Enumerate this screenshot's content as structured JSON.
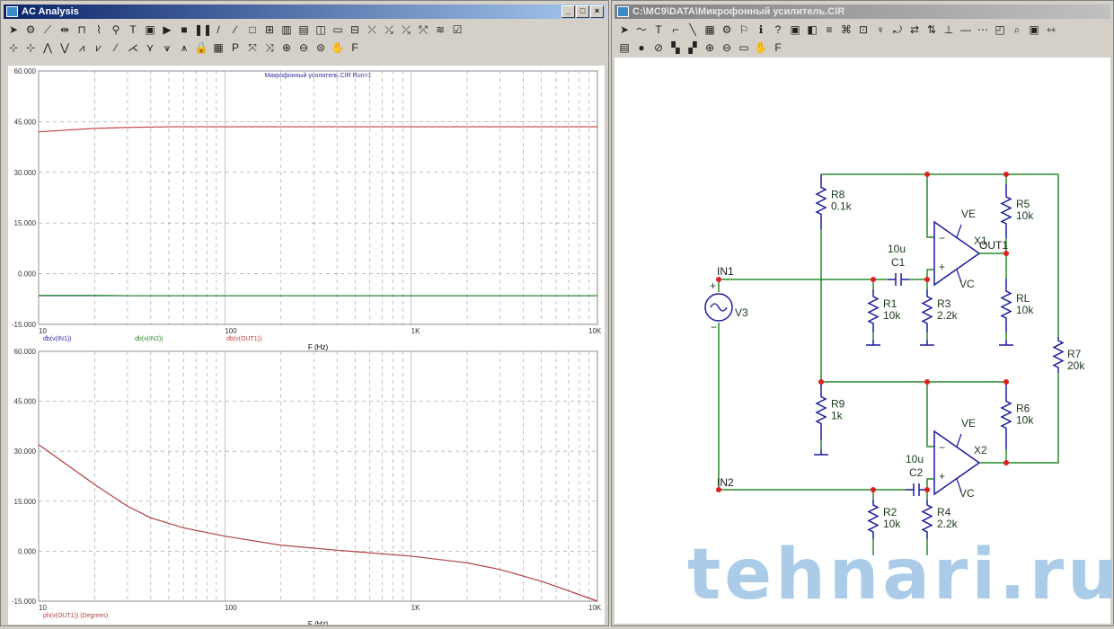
{
  "left_window": {
    "title": "AC Analysis",
    "controls": [
      "_",
      "□",
      "×"
    ],
    "toolbar1": [
      [
        "select-arrow-icon",
        "➤"
      ],
      [
        "components-icon",
        "⚙"
      ],
      [
        "scale-icon",
        "⟋"
      ],
      [
        "cursor-icon",
        "⇹"
      ],
      [
        "peak-icon",
        "⊓"
      ],
      [
        "trace-icon",
        "⌇"
      ],
      [
        "label-icon",
        "⚲"
      ],
      [
        "text-icon",
        "T"
      ],
      [
        "properties-icon",
        "▣"
      ],
      [
        "run-icon",
        "▶"
      ],
      [
        "stop-icon",
        "■"
      ],
      [
        "pause-icon",
        "❚❚"
      ],
      [
        "line-icon",
        "/"
      ],
      [
        "arrow-line-icon",
        "⁄"
      ],
      [
        "frame-icon",
        "□"
      ],
      [
        "grid-icon",
        "⊞"
      ],
      [
        "grid-v-icon",
        "▥"
      ],
      [
        "grid-h-icon",
        "▤"
      ],
      [
        "grid-mix-icon",
        "◫"
      ],
      [
        "grid-off-icon",
        "▭"
      ],
      [
        "plot-split-icon",
        "⊟"
      ],
      [
        "data-point-icon",
        "⤫"
      ],
      [
        "tag-icon",
        "⤯"
      ],
      [
        "tag2-icon",
        "⤰"
      ],
      [
        "tag3-icon",
        "⤱"
      ],
      [
        "tag4-icon",
        "≋"
      ],
      [
        "edit-icon",
        "☑"
      ]
    ],
    "toolbar2": [
      [
        "cursor-left-icon",
        "⊹"
      ],
      [
        "cursor-right-icon",
        "⊹"
      ],
      [
        "peak-icon",
        "⋀"
      ],
      [
        "valley-icon",
        "⋁"
      ],
      [
        "high-icon",
        "⩘"
      ],
      [
        "low-icon",
        "⩗"
      ],
      [
        "slope-icon",
        "⁄"
      ],
      [
        "inflection-icon",
        "⋌"
      ],
      [
        "global-high-icon",
        "⋎"
      ],
      [
        "global-low-icon",
        "⩛"
      ],
      [
        "top-icon",
        "⩚"
      ],
      [
        "lock-icon",
        "🔒"
      ],
      [
        "table-icon",
        "▦"
      ],
      [
        "p-icon",
        "P"
      ],
      [
        "x-scale-icon",
        "⤧"
      ],
      [
        "y-scale-icon",
        "⤨"
      ],
      [
        "zoom-in-icon",
        "⊕"
      ],
      [
        "zoom-out-icon",
        "⊖"
      ],
      [
        "zoom-fit-icon",
        "⊜"
      ],
      [
        "pan-icon",
        "✋"
      ],
      [
        "font-icon",
        "F"
      ]
    ]
  },
  "right_window": {
    "title": "C:\\MC9\\DATA\\Микрофонный усилитель.CIR",
    "toolbar1": [
      [
        "select-arrow-icon",
        "➤"
      ],
      [
        "wire-icon",
        "〜"
      ],
      [
        "text-icon",
        "T"
      ],
      [
        "ortho-wire-icon",
        "⌐"
      ],
      [
        "diag-wire-icon",
        "╲"
      ],
      [
        "component-icon",
        "▦"
      ],
      [
        "components-icon",
        "⚙"
      ],
      [
        "flag-icon",
        "⚐"
      ],
      [
        "info-icon",
        "ℹ"
      ],
      [
        "help-icon",
        "?"
      ],
      [
        "tags-icon",
        "▣"
      ],
      [
        "colors-icon",
        "◧"
      ],
      [
        "text-toggle-icon",
        "≡"
      ],
      [
        "node-numbers-icon",
        "⌘"
      ],
      [
        "pin-icon",
        "⊡"
      ],
      [
        "probe-icon",
        "♆"
      ],
      [
        "rotate-icon",
        "⤾"
      ],
      [
        "flip-icon",
        "⇄"
      ],
      [
        "mirror-icon",
        "⇅"
      ],
      [
        "junction-icon",
        "⊥"
      ],
      [
        "line-icon",
        "—"
      ],
      [
        "grid-icon",
        "⋯"
      ],
      [
        "window-icon",
        "◰"
      ],
      [
        "find-icon",
        "⌕"
      ],
      [
        "properties-icon",
        "▣"
      ],
      [
        "more-icon",
        "⇿"
      ]
    ],
    "toolbar2": [
      [
        "page-icon",
        "▤"
      ],
      [
        "stop-icon",
        "●"
      ],
      [
        "cancel-icon",
        "⊘"
      ],
      [
        "step-icon",
        "▚"
      ],
      [
        "step2-icon",
        "▞"
      ],
      [
        "zoom-in-icon",
        "⊕"
      ],
      [
        "zoom-out-icon",
        "⊖"
      ],
      [
        "fit-icon",
        "▭"
      ],
      [
        "pan-icon",
        "✋"
      ],
      [
        "font-icon",
        "F"
      ]
    ]
  },
  "chart_data": [
    {
      "type": "line",
      "title": "Микрофонный усилитель.CIR Run=1",
      "xlabel": "F (Hz)",
      "xscale": "log",
      "xlim": [
        10,
        10000
      ],
      "ylim": [
        -15,
        60
      ],
      "xticks": [
        "10",
        "100",
        "1K",
        "10K"
      ],
      "yticks": [
        "60.000",
        "45.000",
        "30.000",
        "15.000",
        "0.000",
        "-15.000"
      ],
      "x": [
        10,
        15,
        20,
        30,
        50,
        100,
        1000,
        10000
      ],
      "series": [
        {
          "name": "db(v(IN1))",
          "color": "#3030a0",
          "values": [
            -6.5,
            -6.5,
            -6.5,
            -6.5,
            -6.5,
            -6.5,
            -6.5,
            -6.5
          ]
        },
        {
          "name": "db(v(IN2))",
          "color": "#2a8a2a",
          "values": [
            -6.4,
            -6.4,
            -6.4,
            -6.5,
            -6.5,
            -6.5,
            -6.5,
            -6.5
          ]
        },
        {
          "name": "db(v(OUT1))",
          "color": "#c04040",
          "values": [
            42,
            42.6,
            43,
            43.3,
            43.5,
            43.5,
            43.5,
            43.5
          ]
        }
      ]
    },
    {
      "type": "line",
      "xlabel": "F (Hz)",
      "xscale": "log",
      "xlim": [
        10,
        10000
      ],
      "ylim": [
        -15,
        60
      ],
      "xticks": [
        "10",
        "100",
        "1K",
        "10K"
      ],
      "yticks": [
        "60.000",
        "45.000",
        "30.000",
        "15.000",
        "0.000",
        "-15.000"
      ],
      "x": [
        10,
        15,
        20,
        30,
        40,
        60,
        100,
        200,
        400,
        1000,
        2000,
        3000,
        5000,
        10000
      ],
      "series": [
        {
          "name": "ph(v(OUT1)) (Degrees)",
          "color": "#b04040",
          "values": [
            32,
            25,
            20,
            13.5,
            10,
            7,
            4.5,
            1.8,
            0.3,
            -1.5,
            -3.5,
            -5.5,
            -9,
            -15
          ]
        }
      ]
    }
  ],
  "schematic": {
    "components": [
      {
        "ref": "R8",
        "value": "0.1k"
      },
      {
        "ref": "R5",
        "value": "10k"
      },
      {
        "ref": "R1",
        "value": "10k"
      },
      {
        "ref": "R3",
        "value": "2.2k"
      },
      {
        "ref": "RL",
        "value": "10k"
      },
      {
        "ref": "R7",
        "value": "20k"
      },
      {
        "ref": "R9",
        "value": "1k"
      },
      {
        "ref": "R6",
        "value": "10k"
      },
      {
        "ref": "R2",
        "value": "10k"
      },
      {
        "ref": "R4",
        "value": "2.2k"
      },
      {
        "ref": "C1",
        "value": "10u"
      },
      {
        "ref": "C2",
        "value": "10u"
      },
      {
        "ref": "V3",
        "value": ""
      },
      {
        "ref": "X1",
        "value": ""
      },
      {
        "ref": "X2",
        "value": ""
      }
    ],
    "nodes": [
      "IN1",
      "IN2",
      "OUT1"
    ],
    "supplies": [
      "VE",
      "VC"
    ],
    "wire_color": "#2a8a2a",
    "component_color": "#1a1aa0",
    "node_color": "#e02020"
  },
  "watermark": "tehnari.ru"
}
